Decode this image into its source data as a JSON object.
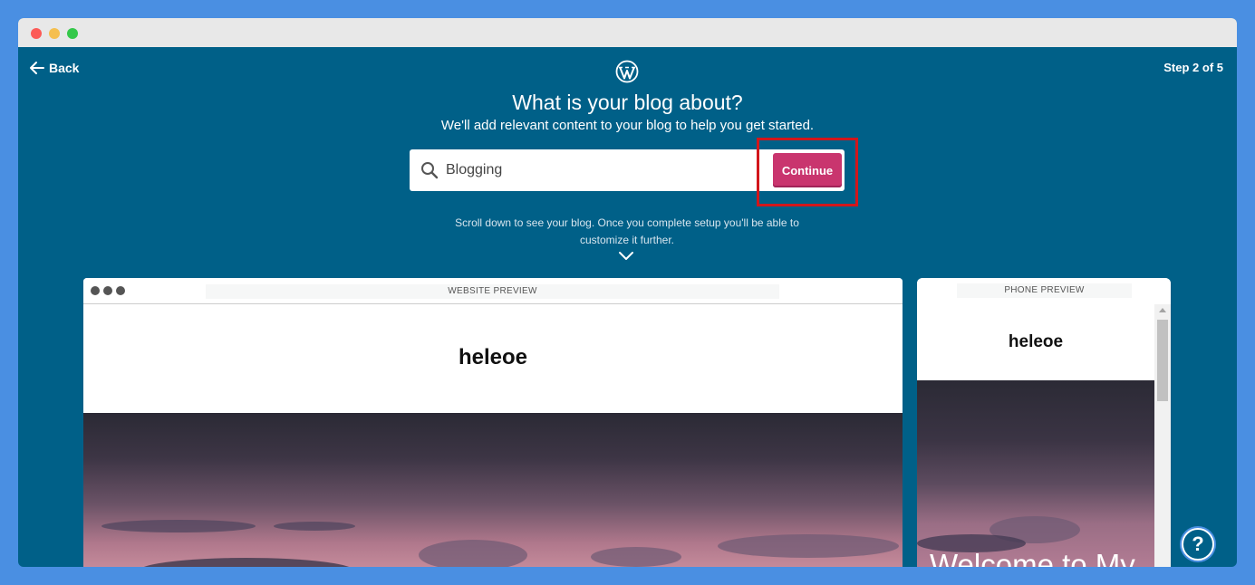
{
  "header": {
    "back_label": "Back",
    "step_label": "Step 2 of 5"
  },
  "main": {
    "title": "What is your blog about?",
    "subtitle": "We'll add relevant content to your blog to help you get started.",
    "search": {
      "value": "Blogging"
    },
    "continue_label": "Continue",
    "scroll_hint": "Scroll down to see your blog. Once you complete setup you'll be able to customize it further."
  },
  "website_preview": {
    "label": "WEBSITE PREVIEW",
    "site_title": "heleoe"
  },
  "phone_preview": {
    "label": "PHONE PREVIEW",
    "site_title": "heleoe",
    "hero_text": "Welcome to My"
  },
  "help": {
    "label": "?"
  },
  "colors": {
    "background": "#006088",
    "accent": "#c9356e",
    "highlight": "#d2161b",
    "page_bg": "#4a8fe2"
  }
}
